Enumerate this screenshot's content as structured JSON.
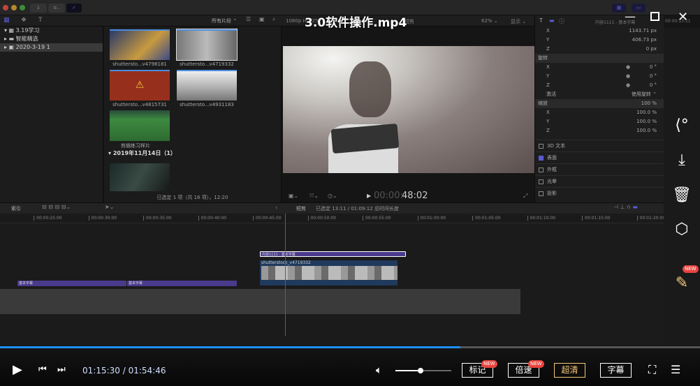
{
  "player": {
    "title": "3.0软件操作.mp4",
    "current_time": "01:15:30",
    "total_time": "01:54:46",
    "time_sep": " / ",
    "progress": 0.658,
    "volume": 0.45,
    "buttons": {
      "mark": "标记",
      "speed": "倍速",
      "quality": "超清",
      "subtitle": "字幕",
      "new_badge": "NEW"
    },
    "window": {
      "minimize": "—",
      "maximize": "☐",
      "close": "✕"
    }
  },
  "app": {
    "toolbar": {
      "filter": "所有片段 ⌃"
    },
    "sidebar": {
      "items": [
        {
          "label": "3.19学习"
        },
        {
          "label": "智能精选"
        },
        {
          "label": "2020-3-19 1"
        }
      ]
    },
    "browser": {
      "clips": [
        {
          "label": "shuttersto...v4798181"
        },
        {
          "label": "shuttersto...v4719332"
        },
        {
          "label": "shuttersto...v4815731"
        },
        {
          "label": "shuttersto...v4931183"
        },
        {
          "label": "剪辑练习样片"
        }
      ],
      "group": "2019年11月14日（1）",
      "status": "已选定 1 项（共 16 项），12:20"
    },
    "viewer": {
      "format": "1080p HD 25",
      "name": "短剪",
      "zoom": "62% ⌄",
      "display": "显示 ⌄",
      "timecode_dim": "00:00:",
      "timecode": "48:02"
    },
    "inspector": {
      "title": "内容1111 - 基本字幕",
      "time": "00:00:13:11",
      "position": [
        {
          "axis": "X",
          "value": "1143.71 px"
        },
        {
          "axis": "Y",
          "value": "406.73 px"
        },
        {
          "axis": "Z",
          "value": "0 px"
        }
      ],
      "rotation_label": "旋转",
      "rotation": [
        {
          "axis": "X",
          "value": "0 °"
        },
        {
          "axis": "Y",
          "value": "0 °"
        },
        {
          "axis": "Z",
          "value": "0 °"
        }
      ],
      "animate_label": "激活",
      "animate_value": "使用旋转 ⌃",
      "scale_label": "缩放",
      "scale_value": "100 %",
      "scale": [
        {
          "axis": "X",
          "value": "100.0 %"
        },
        {
          "axis": "Y",
          "value": "100.0 %"
        },
        {
          "axis": "Z",
          "value": "100.0 %"
        }
      ],
      "sections": [
        {
          "label": "3D 文本",
          "checked": false
        },
        {
          "label": "表面",
          "checked": true
        },
        {
          "label": "外框",
          "checked": false
        },
        {
          "label": "光晕",
          "checked": false
        },
        {
          "label": "投影",
          "checked": false
        }
      ]
    },
    "timeline": {
      "index": "索引",
      "project": "短剪",
      "info": "已选定 13:11 / 01:09:12 总时间长度",
      "ruler": [
        "00:00:25:00",
        "00:00:30:00",
        "00:00:35:00",
        "00:00:40:00",
        "00:00:45:00",
        "00:00:50:00",
        "00:00:55:00",
        "00:01:00:00",
        "00:01:05:00",
        "00:01:10:00",
        "00:01:15:00",
        "00:01:20:00"
      ],
      "title_clip": "内容1111 - 基本字幕",
      "video_clip": "shutterstock_v4719332",
      "sub_clips": [
        "基本字幕",
        "基本字幕"
      ]
    }
  },
  "colors": {
    "accent": "#1e90ff",
    "quality": "#f5c97a",
    "badge": "#e8443f",
    "clip_purple": "#4a3a8c",
    "clip_blue": "#1f3a5c"
  }
}
